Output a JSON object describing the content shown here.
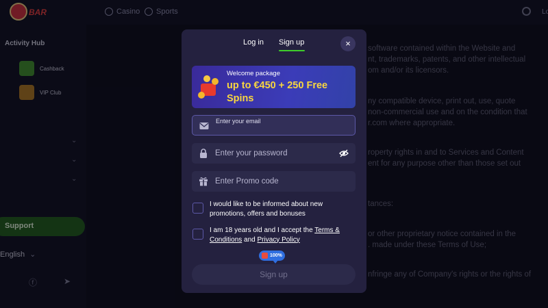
{
  "header": {
    "logo_text": "BAR",
    "nav": [
      {
        "label": "Casino",
        "icon": "casino-icon"
      },
      {
        "label": "Sports",
        "icon": "sports-icon"
      }
    ],
    "login_label": "Lo"
  },
  "sidebar": {
    "section_title": "Activity Hub",
    "items": [
      {
        "label": "Cashback",
        "icon": "cashback-icon"
      },
      {
        "label": "VIP Club",
        "icon": "crown-icon"
      }
    ],
    "support_label": "Support",
    "language": "English"
  },
  "background_text": [
    "software contained within the Website and",
    "nt, trademarks, patents, and other intellectual",
    "om and/or its licensors.",
    "ny compatible device, print out, use, quote",
    "non-commercial use and on the condition that",
    "r.com where appropriate.",
    "roperty rights in and to Services and Content",
    "ent for any purpose other than those set out",
    "tances:",
    "or other proprietary notice contained in the",
    ". made under these Terms of Use;",
    "nfringe any of Company's rights or the rights of"
  ],
  "modal": {
    "tabs": [
      "Log in",
      "Sign up"
    ],
    "active_tab": "Sign up",
    "close_label": "×",
    "promo": {
      "label": "Welcome package",
      "offer": "up to €450 + 250 Free Spins"
    },
    "fields": {
      "email_placeholder": "Enter your email",
      "password_placeholder": "Enter your password",
      "promo_placeholder": "Enter Promo code"
    },
    "checkboxes": {
      "marketing": "I would like to be informed about new promotions, offers and bonuses",
      "terms_prefix": "I am 18 years old and I accept the",
      "terms_link": "Terms & Conditions",
      "terms_and": "and",
      "privacy_link": "Privacy Policy"
    },
    "progress_badge": "100%",
    "progress": 1.0,
    "submit_label": "Sign up"
  },
  "colors": {
    "accent": "#3ecd2a",
    "modal_bg": "#24213f",
    "promo_text": "#f8d640",
    "badge": "#2f6ee0"
  }
}
